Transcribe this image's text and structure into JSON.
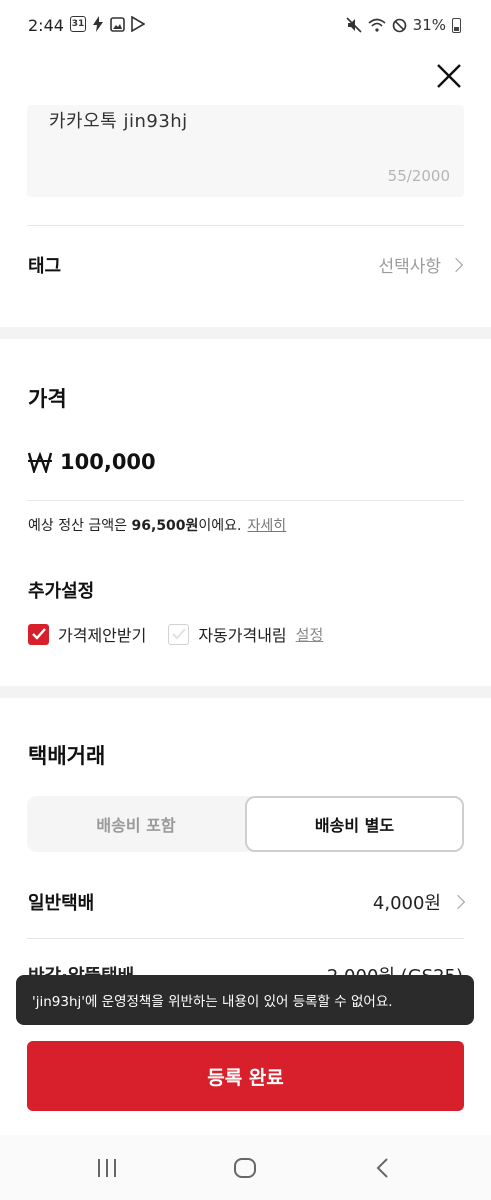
{
  "status_bar": {
    "time": "2:44",
    "calendar_day": "31",
    "battery": "31%"
  },
  "description": {
    "text": "카카오톡 jin93hj",
    "count": "55/2000"
  },
  "tag": {
    "label": "태그",
    "value": "선택사항"
  },
  "price": {
    "title": "가격",
    "amount": "100,000",
    "settle_prefix": "예상 정산 금액은 ",
    "settle_amount": "96,500원",
    "settle_suffix": "이에요.",
    "detail_link": "자세히"
  },
  "extra": {
    "title": "추가설정",
    "offer_label": "가격제안받기",
    "offer_checked": true,
    "auto_label": "자동가격내림",
    "auto_checked": false,
    "setting_link": "설정"
  },
  "shipping": {
    "title": "택배거래",
    "tab_included": "배송비 포함",
    "tab_separate": "배송비 별도",
    "selected_tab": "배송비 별도",
    "rows": [
      {
        "label": "일반택배",
        "price": "4,000원"
      },
      {
        "label": "반값·알뜰택배",
        "price": "2,000원 (GS25)"
      }
    ]
  },
  "toast": {
    "message": "'jin93hj'에 운영정책을 위반하는 내용이 있어 등록할 수 없어요."
  },
  "submit_label": "등록 완료",
  "colors": {
    "accent": "#d8202c",
    "toast_bg": "#2b2b2b"
  }
}
